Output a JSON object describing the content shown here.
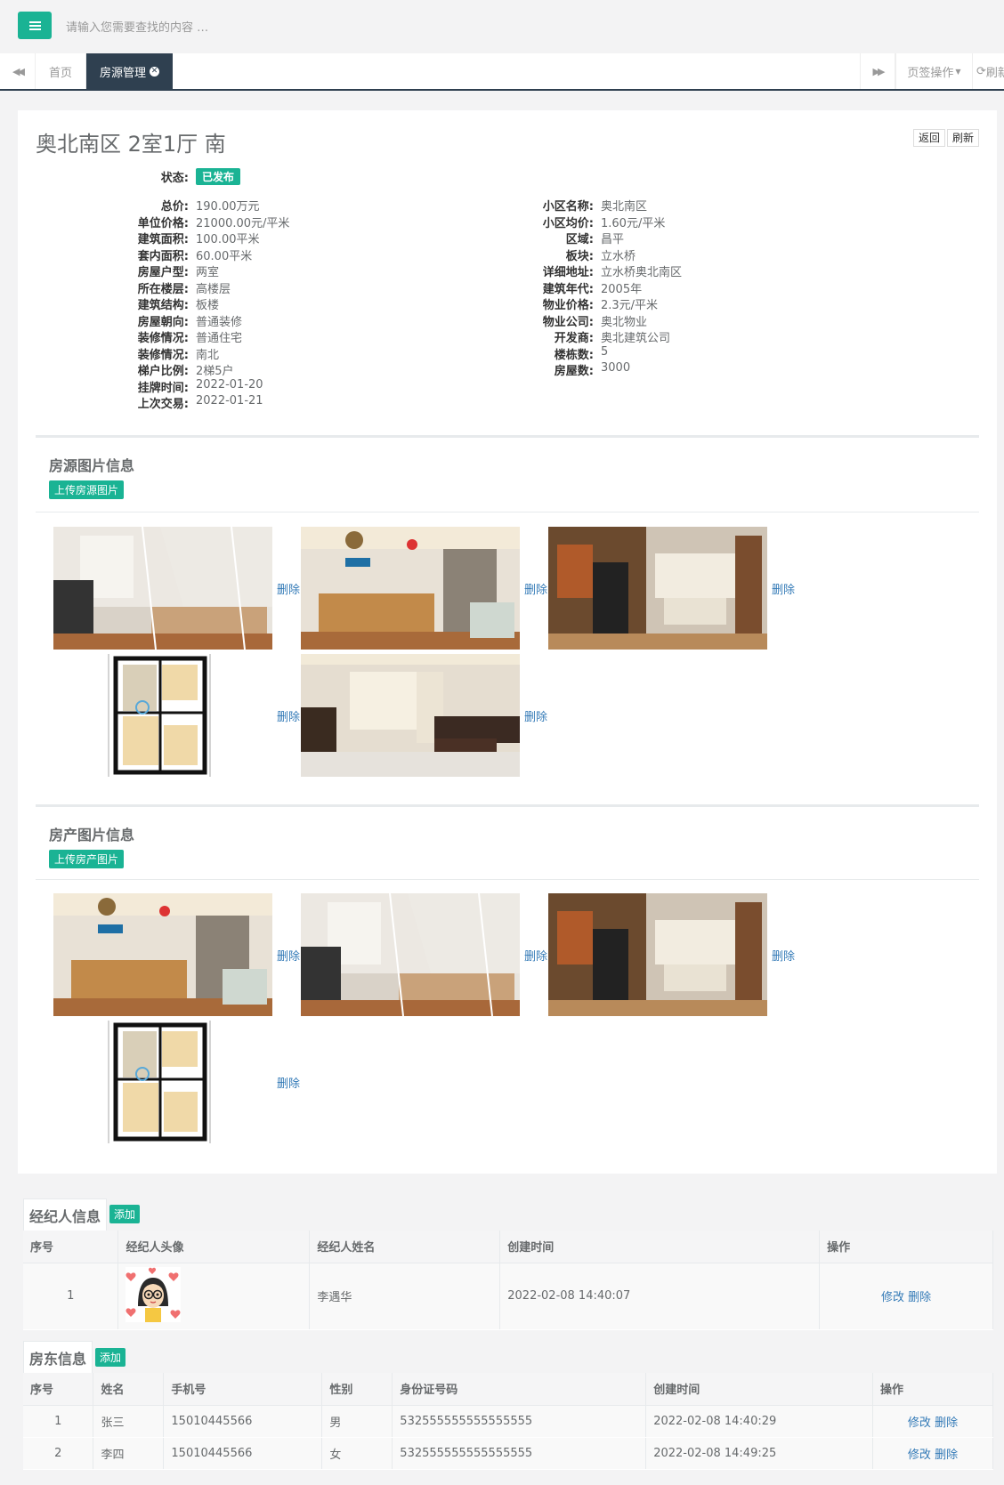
{
  "topbar": {
    "search_placeholder": "请输入您需要查找的内容 …"
  },
  "tabs": {
    "home": "首页",
    "active": "房源管理",
    "ops": "页签操作",
    "refresh": "刷新"
  },
  "house": {
    "title": "奥北南区 2室1厅 南",
    "back_label": "返回",
    "refresh_label": "刷新",
    "status_label": "状态:",
    "status_value": "已发布",
    "left_fields": [
      {
        "label": "总价:",
        "value": "190.00万元"
      },
      {
        "label": "单位价格:",
        "value": "21000.00元/平米"
      },
      {
        "label": "建筑面积:",
        "value": "100.00平米"
      },
      {
        "label": "套内面积:",
        "value": "60.00平米"
      },
      {
        "label": "房屋户型:",
        "value": "两室"
      },
      {
        "label": "所在楼层:",
        "value": "高楼层"
      },
      {
        "label": "建筑结构:",
        "value": "板楼"
      },
      {
        "label": "房屋朝向:",
        "value": "普通装修"
      },
      {
        "label": "装修情况:",
        "value": "普通住宅"
      },
      {
        "label": "装修情况:",
        "value": "南北"
      },
      {
        "label": "梯户比例:",
        "value": "2梯5户"
      },
      {
        "label": "挂牌时间:",
        "value": "2022-01-20"
      },
      {
        "label": "上次交易:",
        "value": "2022-01-21"
      }
    ],
    "right_fields": [
      {
        "label": "小区名称:",
        "value": "奥北南区"
      },
      {
        "label": "小区均价:",
        "value": "1.60元/平米"
      },
      {
        "label": "区域:",
        "value": "昌平"
      },
      {
        "label": "板块:",
        "value": "立水桥"
      },
      {
        "label": "详细地址:",
        "value": "立水桥奥北南区"
      },
      {
        "label": "建筑年代:",
        "value": "2005年"
      },
      {
        "label": "物业价格:",
        "value": "2.3元/平米"
      },
      {
        "label": "物业公司:",
        "value": "奥北物业"
      },
      {
        "label": "开发商:",
        "value": "奥北建筑公司"
      },
      {
        "label": "楼栋数:",
        "value": "5"
      },
      {
        "label": "房屋数:",
        "value": "3000"
      }
    ]
  },
  "listing_photos": {
    "title": "房源图片信息",
    "upload_label": "上传房源图片",
    "delete_label": "删除"
  },
  "property_photos": {
    "title": "房产图片信息",
    "upload_label": "上传房产图片",
    "delete_label": "删除"
  },
  "agents": {
    "title": "经纪人信息",
    "add_label": "添加",
    "headers": [
      "序号",
      "经纪人头像",
      "经纪人姓名",
      "创建时间",
      "操作"
    ],
    "rows": [
      {
        "index": "1",
        "name": "李遇华",
        "created": "2022-02-08 14:40:07",
        "edit": "修改",
        "delete": "删除"
      }
    ]
  },
  "landlords": {
    "title": "房东信息",
    "add_label": "添加",
    "headers": [
      "序号",
      "姓名",
      "手机号",
      "性别",
      "身份证号码",
      "创建时间",
      "操作"
    ],
    "rows": [
      {
        "index": "1",
        "name": "张三",
        "phone": "15010445566",
        "gender": "男",
        "id_card": "532555555555555555",
        "created": "2022-02-08 14:40:29",
        "edit": "修改",
        "delete": "删除"
      },
      {
        "index": "2",
        "name": "李四",
        "phone": "15010445566",
        "gender": "女",
        "id_card": "532555555555555555",
        "created": "2022-02-08 14:49:25",
        "edit": "修改",
        "delete": "删除"
      }
    ]
  }
}
